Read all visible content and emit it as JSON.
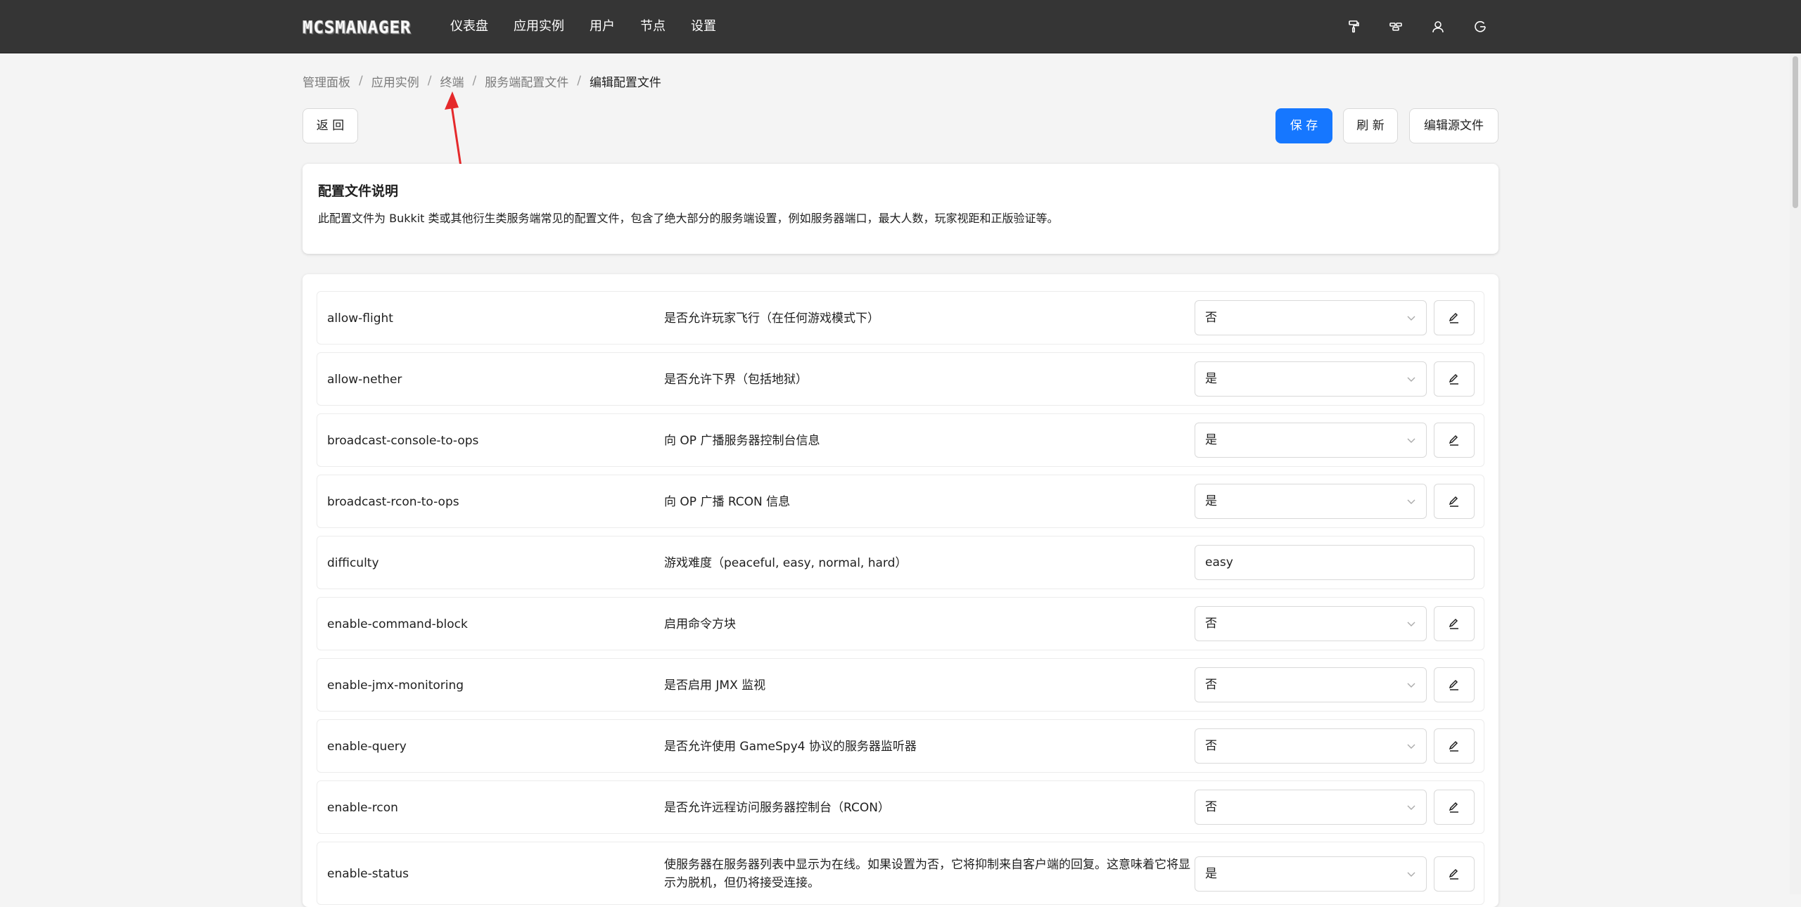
{
  "header": {
    "logo": "MCSMANAGER",
    "nav": [
      {
        "label": "仪表盘"
      },
      {
        "label": "应用实例"
      },
      {
        "label": "用户"
      },
      {
        "label": "节点"
      },
      {
        "label": "设置"
      }
    ],
    "icons": [
      "paint-roller-icon",
      "layout-icon",
      "user-icon",
      "logout-icon"
    ]
  },
  "breadcrumb": [
    {
      "label": "管理面板"
    },
    {
      "label": "应用实例"
    },
    {
      "label": "终端"
    },
    {
      "label": "服务端配置文件"
    },
    {
      "label": "编辑配置文件"
    }
  ],
  "breadcrumb_separator": "/",
  "toolbar": {
    "back_label": "返 回",
    "save_label": "保 存",
    "refresh_label": "刷 新",
    "edit_source_label": "编辑源文件"
  },
  "info": {
    "title": "配置文件说明",
    "description": "此配置文件为 Bukkit 类或其他衍生类服务端常见的配置文件，包含了绝大部分的服务端设置，例如服务器端口，最大人数，玩家视距和正版验证等。"
  },
  "config": [
    {
      "key": "allow-flight",
      "desc": "是否允许玩家飞行（在任何游戏模式下）",
      "type": "select",
      "value": "否"
    },
    {
      "key": "allow-nether",
      "desc": "是否允许下界（包括地狱）",
      "type": "select",
      "value": "是"
    },
    {
      "key": "broadcast-console-to-ops",
      "desc": "向 OP 广播服务器控制台信息",
      "type": "select",
      "value": "是"
    },
    {
      "key": "broadcast-rcon-to-ops",
      "desc": "向 OP 广播 RCON 信息",
      "type": "select",
      "value": "是"
    },
    {
      "key": "difficulty",
      "desc": "游戏难度（peaceful, easy, normal, hard）",
      "type": "input",
      "value": "easy"
    },
    {
      "key": "enable-command-block",
      "desc": "启用命令方块",
      "type": "select",
      "value": "否"
    },
    {
      "key": "enable-jmx-monitoring",
      "desc": "是否启用 JMX 监视",
      "type": "select",
      "value": "否"
    },
    {
      "key": "enable-query",
      "desc": "是否允许使用 GameSpy4 协议的服务器监听器",
      "type": "select",
      "value": "否"
    },
    {
      "key": "enable-rcon",
      "desc": "是否允许远程访问服务器控制台（RCON）",
      "type": "select",
      "value": "否"
    },
    {
      "key": "enable-status",
      "desc": "使服务器在服务器列表中显示为在线。如果设置为否，它将抑制来自客户端的回复。这意味着它将显示为脱机，但仍将接受连接。",
      "type": "select",
      "value": "是"
    }
  ],
  "colors": {
    "topbar": "#353535",
    "primary": "#1677ff",
    "annotation": "#e5292b"
  }
}
